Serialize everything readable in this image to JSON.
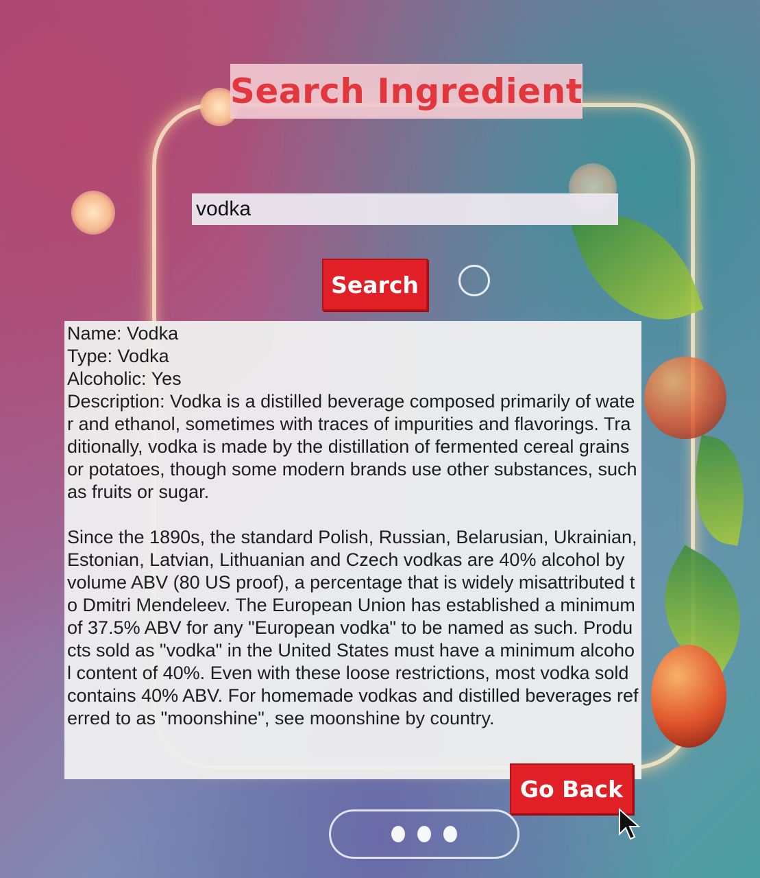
{
  "page": {
    "title": "Search Ingredient"
  },
  "search": {
    "value": "vodka",
    "button_label": "Search"
  },
  "result": {
    "name_line": "Name: Vodka",
    "type_line": "Type: Vodka",
    "alcoholic_line": "Alcoholic: Yes",
    "description_p1": "Description: Vodka is a distilled beverage composed primarily of water and ethanol, sometimes with traces of impurities and flavorings. Traditionally, vodka is made by the distillation of fermented cereal grains or potatoes, though some modern brands use other substances, such as fruits or sugar.",
    "description_p2": "Since the 1890s, the standard Polish, Russian, Belarusian, Ukrainian, Estonian, Latvian, Lithuanian and Czech vodkas are 40% alcohol by volume ABV (80 US proof), a percentage that is widely misattributed to Dmitri Mendeleev. The European Union has established a minimum of 37.5% ABV for any \"European vodka\" to be named as such. Products sold as \"vodka\" in the United States must have a minimum alcohol content of 40%. Even with these loose restrictions, most vodka sold contains 40% ABV. For homemade vodkas and distilled beverages referred to as \"moonshine\", see moonshine by country."
  },
  "actions": {
    "back_label": "Go Back"
  },
  "theme": {
    "accent": "#e11f26",
    "title_color": "#e2373d"
  }
}
